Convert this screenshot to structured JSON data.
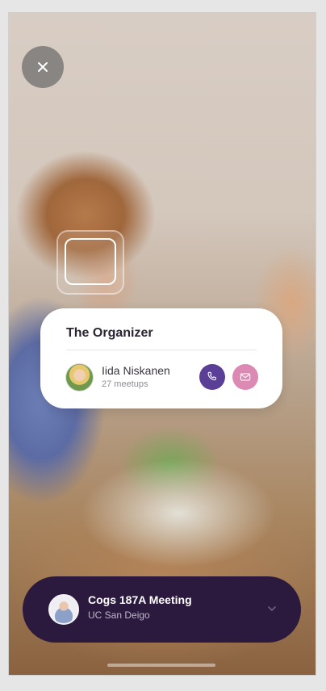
{
  "close_button": {
    "icon": "close-icon"
  },
  "organizer_card": {
    "title": "The Organizer",
    "name": "Iida Niskanen",
    "meta": "27 meetups",
    "call_icon": "phone-icon",
    "mail_icon": "mail-icon",
    "colors": {
      "call": "#5b3f97",
      "mail": "#dc8ab3"
    }
  },
  "event_bar": {
    "title": "Cogs 187A Meeting",
    "subtitle": "UC San Deigo",
    "chevron_icon": "chevron-down-icon",
    "background": "#2b1a3d"
  }
}
